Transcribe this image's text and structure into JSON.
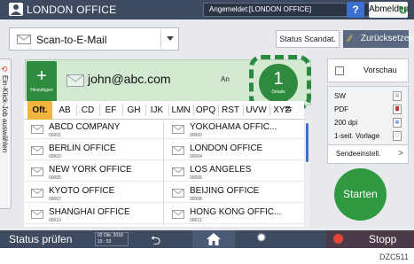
{
  "header": {
    "title": "LONDON OFFICE",
    "login_status": "Angemeldet:[LONDON OFFICE]",
    "help_label": "?",
    "logout_label": "Abmelden"
  },
  "app": {
    "selected_function": "Scan-to-E-Mail",
    "scan_status_label": "Status Scandat.",
    "reset_label": "Zurücksetzen"
  },
  "side_tab": {
    "label": "Ein-Klick-Job auswählen"
  },
  "destination": {
    "manual_label": "Hinzufügen",
    "address": "john@abc.com",
    "type": "An",
    "details_count": "1",
    "details_label": "Details"
  },
  "index_tabs": [
    {
      "label": "Oft.",
      "active": true
    },
    {
      "label": "AB",
      "active": false
    },
    {
      "label": "CD",
      "active": false
    },
    {
      "label": "EF",
      "active": false
    },
    {
      "label": "GH",
      "active": false
    },
    {
      "label": "IJK",
      "active": false
    },
    {
      "label": "LMN",
      "active": false
    },
    {
      "label": "OPQ",
      "active": false
    },
    {
      "label": "RST",
      "active": false
    },
    {
      "label": "UVW",
      "active": false
    },
    {
      "label": "XYZ",
      "active": false
    }
  ],
  "destinations": [
    {
      "name": "ABCD COMPANY",
      "no": "00001"
    },
    {
      "name": "YOKOHAMA OFFIC...",
      "no": "00002"
    },
    {
      "name": "BERLIN OFFICE",
      "no": "00003"
    },
    {
      "name": "LONDON OFFICE",
      "no": "00004"
    },
    {
      "name": "NEW YORK OFFICE",
      "no": "00005"
    },
    {
      "name": "LOS ANGELES",
      "no": "00006"
    },
    {
      "name": "KYOTO OFFICE",
      "no": "00007"
    },
    {
      "name": "BEIJING OFFICE",
      "no": "00008"
    },
    {
      "name": "SHANGHAI  OFFICE",
      "no": "00010"
    },
    {
      "name": "HONG KONG OFFIC...",
      "no": "00011"
    }
  ],
  "preview": {
    "label": "Vorschau",
    "checked": false
  },
  "settings": {
    "color": "SW",
    "format": "PDF",
    "resolution": "200 dpi",
    "original": "1-seit. Vorlage",
    "send_settings_label": "Sendeeinstell."
  },
  "start_label": "Starten",
  "footer": {
    "status_label": "Status prüfen",
    "date": "02 Okt. 2018",
    "time": "15 : 53",
    "stop_label": "Stopp"
  },
  "ref_code": "DZC511",
  "colors": {
    "topbar": "#3d4a5f",
    "accent_green": "#2e8b3e",
    "index_active": "#f4b53f",
    "stop_red": "#e8443a"
  },
  "icons": [
    "user-icon",
    "refresh-icon",
    "envelope-icon",
    "history-icon",
    "undo-icon",
    "home-icon",
    "gear-icon",
    "stop-icon",
    "wrench-icon",
    "chevron-right-icon",
    "swap-icon"
  ]
}
